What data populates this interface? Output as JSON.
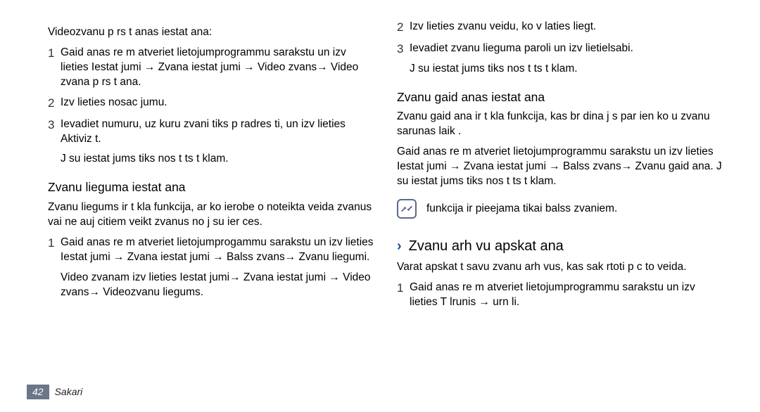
{
  "left": {
    "intro": "Videozvanu p rs t  anas iestat  ana:",
    "item1": "Gaid  anas re  m  atveriet lietojumprogrammu sarakstu un izv lieties Iestat jumi → Zvana iestat jumi → Video zvans→ Video zvana p rs t  ana.",
    "item2": "Izv lieties nosac jumu.",
    "item3": "Ievadiet numuru, uz kuru zvani tiks p radres ti, un izv lieties Aktiviz t.",
    "item3_sub": "J su iestat jums tiks nos t ts t klam.",
    "subhead": "Zvanu lieguma iestat  ana",
    "sub_para": "Zvanu liegums ir t kla funkcija, ar ko ierobe o noteikta veida zvanus vai ne auj citiem veikt zvanus no j su ier ces.",
    "b1": "Gaid  anas re  m  atveriet lietojumprogammu sarakstu un izv lieties Iestat jumi → Zvana iestat jumi → Balss zvans→ Zvanu liegumi.",
    "b1_sub": "Video zvanam izv lieties Iestat jumi→ Zvana iestat jumi → Video zvans→ Videozvanu liegums."
  },
  "right": {
    "r2": "Izv lieties zvanu veidu, ko v laties liegt.",
    "r3": "Ievadiet zvanu lieguma paroli un izv lietielsabi.",
    "r3_sub": "J su iestat jums tiks nos t ts t klam.",
    "subhead": "Zvanu gaid  anas iestat  ana",
    "sub_para": "Zvanu gaid  ana ir t kla funkcija, kas br dina j s par ien ko u zvanu sarunas laik .",
    "sub_para2": "Gaid  anas re  m  atveriet lietojumprogrammu sarakstu un izv lieties Iestat jumi → Zvana iestat jumi → Balss zvans→ Zvanu gaid  ana. J su iestat jums tiks nos t ts t klam.",
    "note": "funkcija ir pieejama tikai balss zvaniem.",
    "section_title": "Zvanu arh vu apskat  ana",
    "sec_para": "Varat apskat t savu zvanu arh vus, kas sak rtoti p c to veida.",
    "s1": "Gaid  anas re  m  atveriet lietojumprogrammu sarakstu un izv lieties T lrunis →  urn li."
  },
  "footer": {
    "page": "42",
    "label": "Sakari"
  }
}
